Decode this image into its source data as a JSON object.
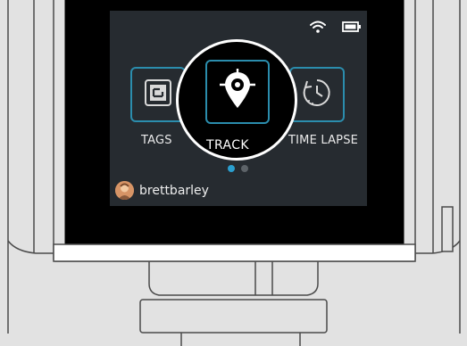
{
  "status_bar": {
    "wifi_icon": "wifi-icon",
    "battery_icon": "battery-icon"
  },
  "menu": {
    "items": [
      {
        "label": "TAGS",
        "icon": "tag-frame-icon",
        "selected": false
      },
      {
        "label": "TRACK",
        "icon": "location-pin-icon",
        "selected": true
      },
      {
        "label": "TIME LAPSE",
        "icon": "clock-timer-icon",
        "selected": false
      }
    ]
  },
  "pagination": {
    "page_count": 2,
    "current_page": 1
  },
  "user": {
    "username": "brettbarley",
    "avatar_icon": "avatar"
  },
  "colors": {
    "screen_bg": "#262b30",
    "accent": "#2b8dad",
    "active_dot": "#2b9fcf",
    "device_bg": "#e2e2e2",
    "outline": "#4a4a4a"
  }
}
